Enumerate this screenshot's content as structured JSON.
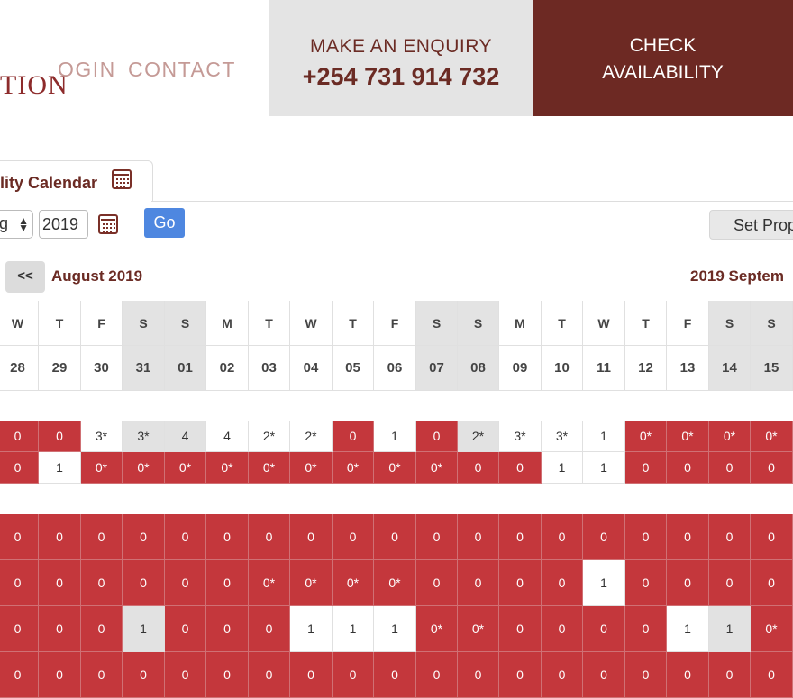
{
  "header": {
    "logo": "TION",
    "nav": {
      "login": "OGIN",
      "contact": "CONTACT"
    },
    "enquiry": {
      "label": "MAKE AN ENQUIRY",
      "phone": "+254 731 914 732"
    },
    "check": {
      "line1": "CHECK",
      "line2": "AVAILABILITY"
    }
  },
  "calendar_tab": {
    "label": "lity Calendar"
  },
  "controls": {
    "month_value": "g",
    "year_value": "2019",
    "go_label": "Go",
    "set_label": "Set Prop"
  },
  "nav": {
    "prev_label": "<<",
    "month_left": "August 2019",
    "month_right": "2019 Septem"
  },
  "colors": {
    "booked": "#c4373c",
    "available": "#ffffff",
    "weekend": "#e3e3e3",
    "brand": "#6d2923"
  },
  "weekdays": [
    "W",
    "T",
    "F",
    "S",
    "S",
    "M",
    "T",
    "W",
    "T",
    "F",
    "S",
    "S",
    "M",
    "T",
    "W",
    "T",
    "F",
    "S",
    "S"
  ],
  "dates": [
    "28",
    "29",
    "30",
    "31",
    "01",
    "02",
    "03",
    "04",
    "05",
    "06",
    "07",
    "08",
    "09",
    "10",
    "11",
    "12",
    "13",
    "14",
    "15"
  ],
  "weekend_cols": [
    3,
    4,
    10,
    11,
    17,
    18
  ],
  "group_a": [
    [
      {
        "v": "0",
        "s": "r"
      },
      {
        "v": "0",
        "s": "r"
      },
      {
        "v": "3*",
        "s": "w"
      },
      {
        "v": "3*",
        "s": "g"
      },
      {
        "v": "4",
        "s": "g"
      },
      {
        "v": "4",
        "s": "w"
      },
      {
        "v": "2*",
        "s": "w"
      },
      {
        "v": "2*",
        "s": "w"
      },
      {
        "v": "0",
        "s": "r"
      },
      {
        "v": "1",
        "s": "w"
      },
      {
        "v": "0",
        "s": "r"
      },
      {
        "v": "2*",
        "s": "g"
      },
      {
        "v": "3*",
        "s": "w"
      },
      {
        "v": "3*",
        "s": "w"
      },
      {
        "v": "1",
        "s": "w"
      },
      {
        "v": "0*",
        "s": "r"
      },
      {
        "v": "0*",
        "s": "r"
      },
      {
        "v": "0*",
        "s": "r"
      },
      {
        "v": "0*",
        "s": "r"
      }
    ],
    [
      {
        "v": "0",
        "s": "r"
      },
      {
        "v": "1",
        "s": "w"
      },
      {
        "v": "0*",
        "s": "r"
      },
      {
        "v": "0*",
        "s": "r"
      },
      {
        "v": "0*",
        "s": "r"
      },
      {
        "v": "0*",
        "s": "r"
      },
      {
        "v": "0*",
        "s": "r"
      },
      {
        "v": "0*",
        "s": "r"
      },
      {
        "v": "0*",
        "s": "r"
      },
      {
        "v": "0*",
        "s": "r"
      },
      {
        "v": "0*",
        "s": "r"
      },
      {
        "v": "0",
        "s": "r"
      },
      {
        "v": "0",
        "s": "r"
      },
      {
        "v": "1",
        "s": "w"
      },
      {
        "v": "1",
        "s": "w"
      },
      {
        "v": "0",
        "s": "r"
      },
      {
        "v": "0",
        "s": "r"
      },
      {
        "v": "0",
        "s": "r"
      },
      {
        "v": "0",
        "s": "r"
      }
    ]
  ],
  "group_b": [
    [
      {
        "v": "0",
        "s": "r"
      },
      {
        "v": "0",
        "s": "r"
      },
      {
        "v": "0",
        "s": "r"
      },
      {
        "v": "0",
        "s": "r"
      },
      {
        "v": "0",
        "s": "r"
      },
      {
        "v": "0",
        "s": "r"
      },
      {
        "v": "0",
        "s": "r"
      },
      {
        "v": "0",
        "s": "r"
      },
      {
        "v": "0",
        "s": "r"
      },
      {
        "v": "0",
        "s": "r"
      },
      {
        "v": "0",
        "s": "r"
      },
      {
        "v": "0",
        "s": "r"
      },
      {
        "v": "0",
        "s": "r"
      },
      {
        "v": "0",
        "s": "r"
      },
      {
        "v": "0",
        "s": "r"
      },
      {
        "v": "0",
        "s": "r"
      },
      {
        "v": "0",
        "s": "r"
      },
      {
        "v": "0",
        "s": "r"
      },
      {
        "v": "0",
        "s": "r"
      }
    ],
    [
      {
        "v": "0",
        "s": "r"
      },
      {
        "v": "0",
        "s": "r"
      },
      {
        "v": "0",
        "s": "r"
      },
      {
        "v": "0",
        "s": "r"
      },
      {
        "v": "0",
        "s": "r"
      },
      {
        "v": "0",
        "s": "r"
      },
      {
        "v": "0*",
        "s": "r"
      },
      {
        "v": "0*",
        "s": "r"
      },
      {
        "v": "0*",
        "s": "r"
      },
      {
        "v": "0*",
        "s": "r"
      },
      {
        "v": "0",
        "s": "r"
      },
      {
        "v": "0",
        "s": "r"
      },
      {
        "v": "0",
        "s": "r"
      },
      {
        "v": "0",
        "s": "r"
      },
      {
        "v": "1",
        "s": "w"
      },
      {
        "v": "0",
        "s": "r"
      },
      {
        "v": "0",
        "s": "r"
      },
      {
        "v": "0",
        "s": "r"
      },
      {
        "v": "0",
        "s": "r"
      }
    ],
    [
      {
        "v": "0",
        "s": "r"
      },
      {
        "v": "0",
        "s": "r"
      },
      {
        "v": "0",
        "s": "r"
      },
      {
        "v": "1",
        "s": "g"
      },
      {
        "v": "0",
        "s": "r"
      },
      {
        "v": "0",
        "s": "r"
      },
      {
        "v": "0",
        "s": "r"
      },
      {
        "v": "1",
        "s": "w"
      },
      {
        "v": "1",
        "s": "w"
      },
      {
        "v": "1",
        "s": "w"
      },
      {
        "v": "0*",
        "s": "r"
      },
      {
        "v": "0*",
        "s": "r"
      },
      {
        "v": "0",
        "s": "r"
      },
      {
        "v": "0",
        "s": "r"
      },
      {
        "v": "0",
        "s": "r"
      },
      {
        "v": "0",
        "s": "r"
      },
      {
        "v": "1",
        "s": "w"
      },
      {
        "v": "1",
        "s": "g"
      },
      {
        "v": "0*",
        "s": "r"
      }
    ],
    [
      {
        "v": "0",
        "s": "r"
      },
      {
        "v": "0",
        "s": "r"
      },
      {
        "v": "0",
        "s": "r"
      },
      {
        "v": "0",
        "s": "r"
      },
      {
        "v": "0",
        "s": "r"
      },
      {
        "v": "0",
        "s": "r"
      },
      {
        "v": "0",
        "s": "r"
      },
      {
        "v": "0",
        "s": "r"
      },
      {
        "v": "0",
        "s": "r"
      },
      {
        "v": "0",
        "s": "r"
      },
      {
        "v": "0",
        "s": "r"
      },
      {
        "v": "0",
        "s": "r"
      },
      {
        "v": "0",
        "s": "r"
      },
      {
        "v": "0",
        "s": "r"
      },
      {
        "v": "0",
        "s": "r"
      },
      {
        "v": "0",
        "s": "r"
      },
      {
        "v": "0",
        "s": "r"
      },
      {
        "v": "0",
        "s": "r"
      },
      {
        "v": "0",
        "s": "r"
      }
    ]
  ]
}
